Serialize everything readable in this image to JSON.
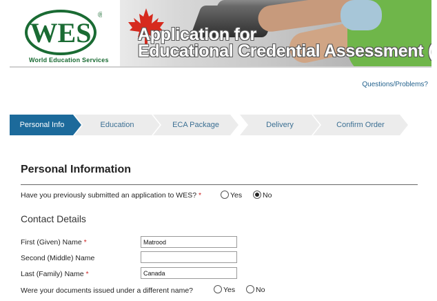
{
  "header": {
    "logo_text": "WES",
    "logo_registered": "®",
    "logo_subtitle": "World Education Services",
    "banner_line1": "Application for",
    "banner_line2": "Educational Credential Assessment (ECA)",
    "colors": {
      "logo_green": "#1a6b33",
      "maple_red": "#d62a1e"
    }
  },
  "help_link": "Questions/Problems?",
  "steps": [
    {
      "label": "Personal Info",
      "active": true
    },
    {
      "label": "Education",
      "active": false
    },
    {
      "label": "ECA Package",
      "active": false
    },
    {
      "label": "Delivery",
      "active": false
    },
    {
      "label": "Confirm Order",
      "active": false
    }
  ],
  "section": {
    "title": "Personal Information",
    "prev_question": "Have you previously submitted an application to WES?",
    "required_mark": "*",
    "yes_label": "Yes",
    "no_label": "No",
    "prev_selected": "No"
  },
  "contact": {
    "title": "Contact Details",
    "first_name_label": "First (Given) Name",
    "first_name_value": "Matrood",
    "middle_name_label": "Second (Middle) Name",
    "middle_name_value": "",
    "last_name_label": "Last (Family) Name",
    "last_name_value": "Canada",
    "different_name_question": "Were your documents issued under a different name?",
    "diff_yes_label": "Yes",
    "diff_no_label": "No",
    "diff_selected": ""
  },
  "colors": {
    "active_step": "#1c6a9b",
    "step_bg": "#ececec",
    "link": "#1f5f8b",
    "required": "#cc2222"
  }
}
